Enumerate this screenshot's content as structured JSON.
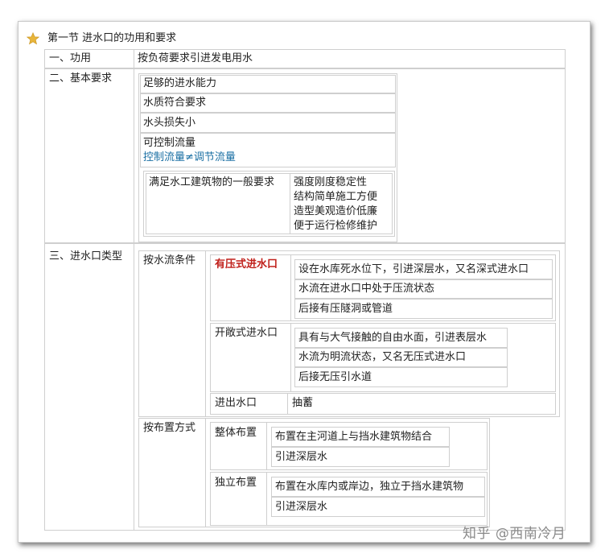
{
  "title": "第一节 进水口的功用和要求",
  "sec1": {
    "label": "一、功用",
    "text": "按负荷要求引进发电用水"
  },
  "sec2": {
    "label": "二、基本要求",
    "items": [
      "足够的进水能力",
      "水质符合要求",
      "水头损失小",
      "可控制流量"
    ],
    "note": "控制流量≠调节流量",
    "general_label": "满足水工建筑物的一般要求",
    "general_items": [
      "强度刚度稳定性",
      "结构简单施工方便",
      "造型美观造价低廉",
      "便于运行检修维护"
    ]
  },
  "sec3": {
    "label": "三、进水口类型",
    "flow": {
      "label": "按水流条件",
      "pressure": {
        "label": "有压式进水口",
        "items": [
          "设在水库死水位下，引进深层水，又名深式进水口",
          "水流在进水口中处于压流状态",
          "后接有压隧洞或管道"
        ]
      },
      "open": {
        "label": "开敞式进水口",
        "items": [
          "具有与大气接触的自由水面，引进表层水",
          "水流为明流状态，又名无压式进水口",
          "后接无压引水道"
        ]
      },
      "outlet": {
        "label": "进出水口",
        "text": "抽蓄"
      }
    },
    "layout": {
      "label": "按布置方式",
      "whole": {
        "label": "整体布置",
        "items": [
          "布置在主河道上与挡水建筑物结合",
          "引进深层水"
        ]
      },
      "independent": {
        "label": "独立布置",
        "items": [
          "布置在水库内或岸边，独立于挡水建筑物",
          "引进深层水"
        ]
      }
    }
  },
  "watermark": "知乎 @西南冷月"
}
